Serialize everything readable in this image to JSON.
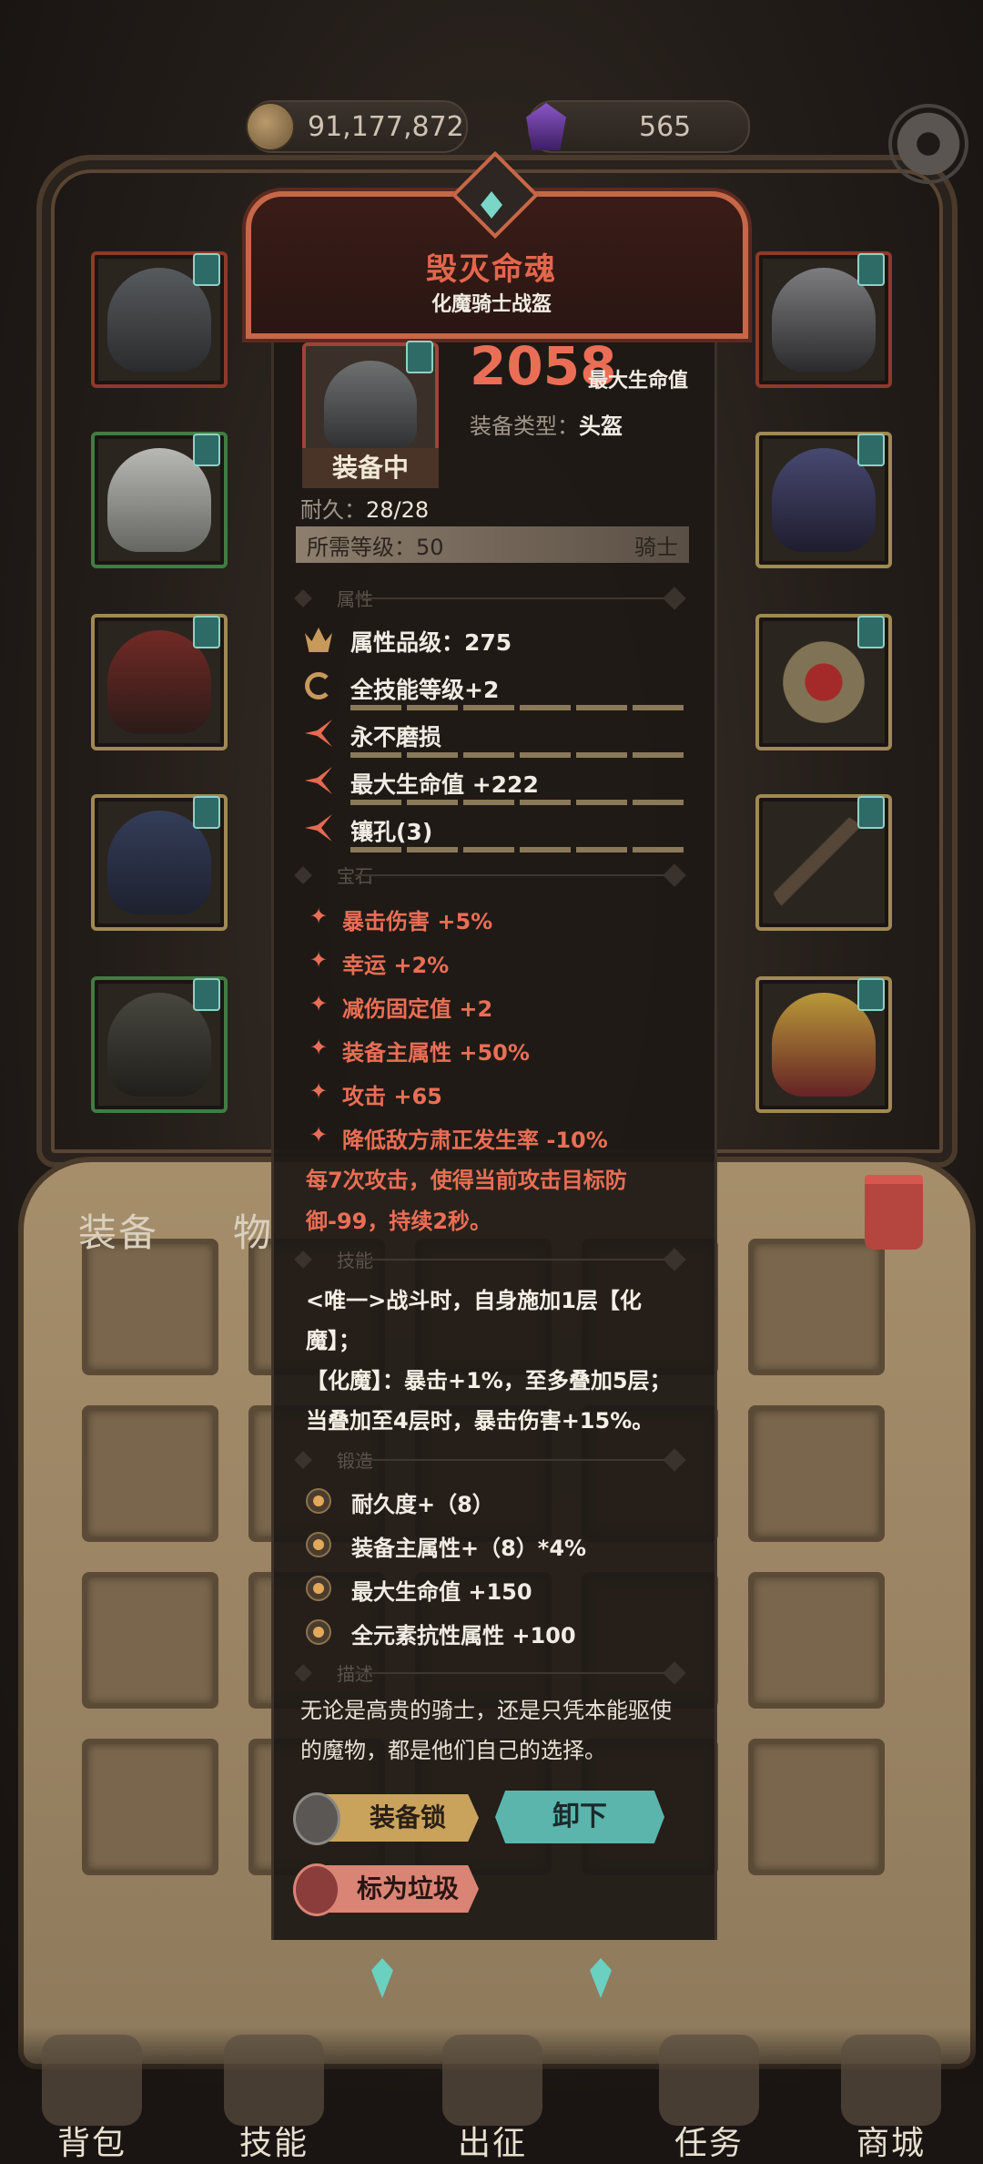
{
  "top_bar": {
    "gold": "91,177,872",
    "gems": "565",
    "colors": {
      "gold_coin": "#b99a6b",
      "gem": "#8a56c6"
    }
  },
  "equip_slots": {
    "left": [
      "helmet-dark",
      "armor-silver",
      "gauntlet-red",
      "belt-blue",
      "boots-dark"
    ],
    "right": [
      "helmet-horned",
      "cloak-demon",
      "ring-red",
      "sword-dark",
      "emblem-gold"
    ]
  },
  "side_tabs": {
    "equipment": "装备",
    "items": "物"
  },
  "item": {
    "name": "毁灭命魂",
    "subtitle": "化魔骑士战盔",
    "equipped_label": "装备中",
    "main_stat_value": "2058",
    "main_stat_label": "最大生命值",
    "type_label": "装备类型：",
    "type_value": "头盔",
    "durability_label": "耐久：",
    "durability_value": "28/28",
    "required_level": "所需等级：50",
    "class": "骑士"
  },
  "sections": {
    "attributes": "属性",
    "gems": "宝石",
    "skills": "技能",
    "forge": "锻造",
    "description": "描述"
  },
  "attributes": [
    {
      "icon": "crown-icon",
      "text": "属性品级：275"
    },
    {
      "icon": "cycle-icon",
      "text": "全技能等级+2"
    },
    {
      "icon": "spark-icon",
      "text": "永不磨损"
    },
    {
      "icon": "spark-icon",
      "text": "最大生命值 +222"
    },
    {
      "icon": "spark-icon",
      "text": "镶孔(3)"
    }
  ],
  "gem_stats": [
    "暴击伤害 +5%",
    "幸运 +2%",
    "减伤固定值 +2",
    "装备主属性 +50%",
    "攻击 +65",
    "降低敌方肃正发生率 -10%"
  ],
  "gem_effect": "每7次攻击，使得当前攻击目标防御-99，持续2秒。",
  "skill_text": {
    "line1": "<唯一>战斗时，自身施加1层【化魔】；",
    "line2": "【化魔】：暴击+1%，至多叠加5层；当叠加至4层时，暴击伤害+15%。"
  },
  "forge_stats": [
    "耐久度+（8）",
    "装备主属性+（8）*4%",
    "最大生命值 +150",
    "全元素抗性属性 +100"
  ],
  "description": "无论是高贵的骑士，还是只凭本能驱使的魔物，都是他们自己的选择。",
  "buttons": {
    "lock": "装备锁",
    "unequip": "卸下",
    "mark_junk": "标为垃圾"
  },
  "bottom_nav": [
    "背包",
    "技能",
    "出征",
    "任务",
    "商城"
  ],
  "colors": {
    "accent_red": "#ea6e55",
    "teal": "#5bb5ad",
    "gold": "#c9a35c"
  }
}
